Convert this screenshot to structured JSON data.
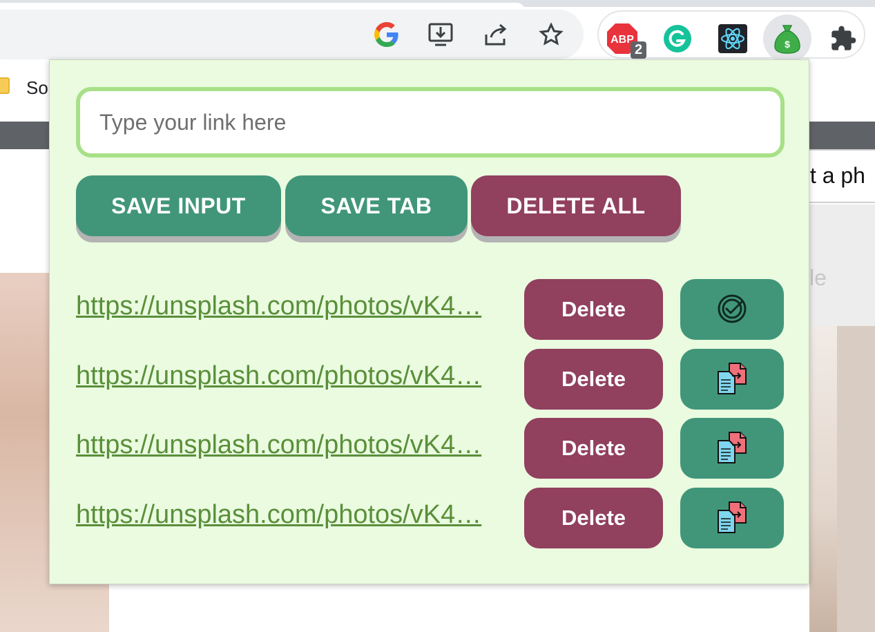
{
  "browser": {
    "bookmark_label": "So",
    "adblock_badge": "2",
    "adblock_text": "ABP",
    "icons": [
      "google-icon",
      "install-app-icon",
      "share-icon",
      "star-icon",
      "adblock-plus-icon",
      "grammarly-icon",
      "react-devtools-icon",
      "money-bag-icon",
      "puzzle-icon"
    ]
  },
  "background_page": {
    "submit_text": "nit a ph",
    "faded_text": "le"
  },
  "popup": {
    "input": {
      "value": "",
      "placeholder": "Type your link here"
    },
    "buttons": {
      "save_input": "SAVE INPUT",
      "save_tab": "SAVE TAB",
      "delete_all": "DELETE ALL"
    },
    "links": [
      {
        "url": "https://unsplash.com/photos/vK4…",
        "delete_label": "Delete",
        "copy_state": "copied"
      },
      {
        "url": "https://unsplash.com/photos/vK4…",
        "delete_label": "Delete",
        "copy_state": "copy"
      },
      {
        "url": "https://unsplash.com/photos/vK4…",
        "delete_label": "Delete",
        "copy_state": "copy"
      },
      {
        "url": "https://unsplash.com/photos/vK4…",
        "delete_label": "Delete",
        "copy_state": "copy"
      }
    ]
  },
  "colors": {
    "popup_bg": "#eafbe0",
    "green": "#41967a",
    "red": "#91405e",
    "link": "#5a8f3a",
    "input_border": "#a8e088"
  }
}
